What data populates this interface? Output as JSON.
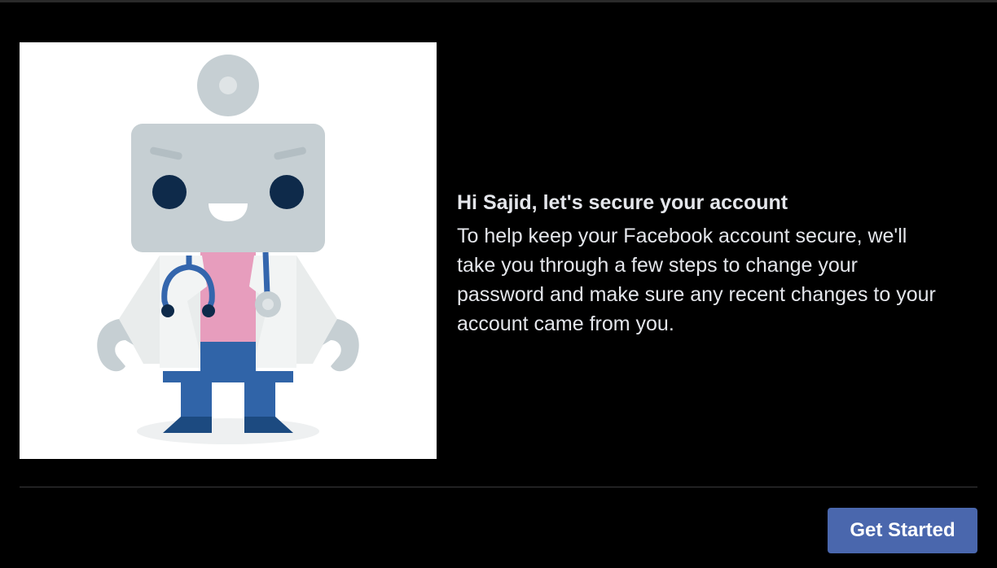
{
  "dialog": {
    "title": "Hi Sajid, let's secure your account",
    "body": "To help keep your Facebook account secure, we'll take you through a few steps to change your password and make sure any recent changes to your account came from you.",
    "primary_button_label": "Get Started",
    "illustration": "doctor-robot-illustration"
  },
  "colors": {
    "background": "#000000",
    "text": "#e4e6eb",
    "button": "#4a67ad",
    "divider": "#3a3b3c"
  }
}
